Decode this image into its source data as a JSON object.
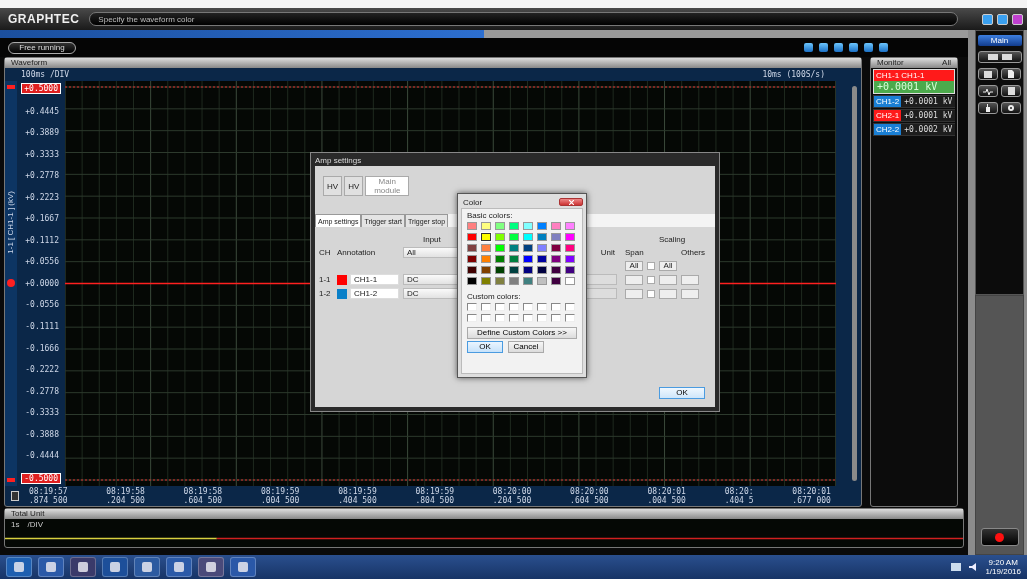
{
  "header": {
    "logo": "GRAPHTEC",
    "message": "Specify the waveform color"
  },
  "toolbar": {
    "mode_button": "Free running"
  },
  "waveform": {
    "title": "Waveform",
    "time_div": "100ms /DIV",
    "sampling": "10ms (100S/s)",
    "axis_title": "1-1 [ CH1-1 ] (kV)",
    "y_labels": [
      {
        "text": "+0.5000",
        "kind": "limit"
      },
      {
        "text": "+0.4445",
        "kind": "tick"
      },
      {
        "text": "+0.3889",
        "kind": "tick"
      },
      {
        "text": "+0.3333",
        "kind": "tick"
      },
      {
        "text": "+0.2778",
        "kind": "tick"
      },
      {
        "text": "+0.2223",
        "kind": "tick"
      },
      {
        "text": "+0.1667",
        "kind": "tick"
      },
      {
        "text": "+0.1112",
        "kind": "tick"
      },
      {
        "text": "+0.0556",
        "kind": "tick"
      },
      {
        "text": "+0.0000",
        "kind": "tick"
      },
      {
        "text": "-0.0556",
        "kind": "tick"
      },
      {
        "text": "-0.1111",
        "kind": "tick"
      },
      {
        "text": "-0.1666",
        "kind": "tick"
      },
      {
        "text": "-0.2222",
        "kind": "tick"
      },
      {
        "text": "-0.2778",
        "kind": "tick"
      },
      {
        "text": "-0.3333",
        "kind": "tick"
      },
      {
        "text": "-0.3888",
        "kind": "tick"
      },
      {
        "text": "-0.4444",
        "kind": "tick"
      },
      {
        "text": "-0.5000",
        "kind": "limit"
      }
    ],
    "time_labels": [
      {
        "time": "08:19:57",
        "fraction": ".874 500"
      },
      {
        "time": "08:19:58",
        "fraction": ".204 500"
      },
      {
        "time": "08:19:58",
        "fraction": ".604 500"
      },
      {
        "time": "08:19:59",
        "fraction": ".004 500"
      },
      {
        "time": "08:19:59",
        "fraction": ".404 500"
      },
      {
        "time": "08:19:59",
        "fraction": ".804 500"
      },
      {
        "time": "08:20:00",
        "fraction": ".204 500"
      },
      {
        "time": "08:20:00",
        "fraction": ".604 500"
      },
      {
        "time": "08:20:01",
        "fraction": ".004 500"
      },
      {
        "time": "08:20:",
        "fraction": ".404 5"
      },
      {
        "time": "08:20:01",
        "fraction": ".677 000"
      }
    ]
  },
  "monitor": {
    "title": "Monitor",
    "filter": "All",
    "channels": [
      {
        "name": "CH1-1 CH1-1",
        "value": "+0.0001",
        "unit": "kV",
        "color": "#ff1a1a",
        "selected": true
      },
      {
        "name": "CH1-2",
        "value": "+0.0001",
        "unit": "kV",
        "color": "#1a7fd4",
        "selected": false
      },
      {
        "name": "CH2-1",
        "value": "+0.0001",
        "unit": "kV",
        "color": "#ff1a1a",
        "selected": false
      },
      {
        "name": "CH2-2",
        "value": "+0.0002",
        "unit": "kV",
        "color": "#1a7fd4",
        "selected": false
      }
    ]
  },
  "side_panel": {
    "tab": "Main"
  },
  "total_unit": {
    "title": "Total Unit",
    "time_div": "1s",
    "div_label": "/DIV"
  },
  "amp_dialog": {
    "title": "Amp settings",
    "modules": [
      {
        "label": "HV",
        "selected": false
      },
      {
        "label": "HV",
        "selected": false
      },
      {
        "label": "Main module",
        "selected": true
      }
    ],
    "tabs": [
      {
        "label": "Amp settings",
        "selected": true
      },
      {
        "label": "Trigger start",
        "selected": false
      },
      {
        "label": "Trigger stop",
        "selected": false
      }
    ],
    "headers": {
      "ch": "CH",
      "annotation": "Annotation",
      "input": "Input",
      "unit": "Unit",
      "span": "Span",
      "scaling": "Scaling",
      "others": "Others"
    },
    "input_all": "All",
    "span_all": "All",
    "scaling_all": "All",
    "scaling_all_checked": false,
    "rows": [
      {
        "ch": "1-1",
        "color": "#ff0000",
        "annotation": "CH1-1",
        "input": "DC",
        "scaling_checked": false
      },
      {
        "ch": "1-2",
        "color": "#0a80c8",
        "annotation": "CH1-2",
        "input": "DC",
        "scaling_checked": false
      }
    ],
    "ok": "OK"
  },
  "color_dialog": {
    "title": "Color",
    "basic_label": "Basic colors:",
    "custom_label": "Custom colors:",
    "define_button": "Define Custom Colors >>",
    "ok": "OK",
    "cancel": "Cancel",
    "basic_colors": [
      {
        "color": "#ff8080",
        "selected": false
      },
      {
        "color": "#ffff80",
        "selected": false
      },
      {
        "color": "#80ff80",
        "selected": false
      },
      {
        "color": "#00ff80",
        "selected": false
      },
      {
        "color": "#80ffff",
        "selected": false
      },
      {
        "color": "#0080ff",
        "selected": false
      },
      {
        "color": "#ff80c0",
        "selected": false
      },
      {
        "color": "#ff80ff",
        "selected": false
      },
      {
        "color": "#ff0000",
        "selected": false
      },
      {
        "color": "#ffff00",
        "selected": true
      },
      {
        "color": "#80ff00",
        "selected": false
      },
      {
        "color": "#00ff40",
        "selected": false
      },
      {
        "color": "#00ffff",
        "selected": false
      },
      {
        "color": "#0080c0",
        "selected": false
      },
      {
        "color": "#8080c0",
        "selected": false
      },
      {
        "color": "#ff00ff",
        "selected": false
      },
      {
        "color": "#804040",
        "selected": false
      },
      {
        "color": "#ff8040",
        "selected": false
      },
      {
        "color": "#00ff00",
        "selected": false
      },
      {
        "color": "#008080",
        "selected": false
      },
      {
        "color": "#004080",
        "selected": false
      },
      {
        "color": "#8080ff",
        "selected": false
      },
      {
        "color": "#800040",
        "selected": false
      },
      {
        "color": "#ff0080",
        "selected": false
      },
      {
        "color": "#800000",
        "selected": false
      },
      {
        "color": "#ff8000",
        "selected": false
      },
      {
        "color": "#008000",
        "selected": false
      },
      {
        "color": "#008040",
        "selected": false
      },
      {
        "color": "#0000ff",
        "selected": false
      },
      {
        "color": "#0000a0",
        "selected": false
      },
      {
        "color": "#800080",
        "selected": false
      },
      {
        "color": "#8000ff",
        "selected": false
      },
      {
        "color": "#400000",
        "selected": false
      },
      {
        "color": "#804000",
        "selected": false
      },
      {
        "color": "#004000",
        "selected": false
      },
      {
        "color": "#004040",
        "selected": false
      },
      {
        "color": "#000080",
        "selected": false
      },
      {
        "color": "#000040",
        "selected": false
      },
      {
        "color": "#400040",
        "selected": false
      },
      {
        "color": "#400080",
        "selected": false
      },
      {
        "color": "#000000",
        "selected": false
      },
      {
        "color": "#808000",
        "selected": false
      },
      {
        "color": "#808040",
        "selected": false
      },
      {
        "color": "#808080",
        "selected": false
      },
      {
        "color": "#408080",
        "selected": false
      },
      {
        "color": "#c0c0c0",
        "selected": false
      },
      {
        "color": "#400040",
        "selected": false
      },
      {
        "color": "#ffffff",
        "selected": false
      }
    ]
  },
  "taskbar": {
    "time": "9:20 AM",
    "date": "1/19/2016"
  }
}
